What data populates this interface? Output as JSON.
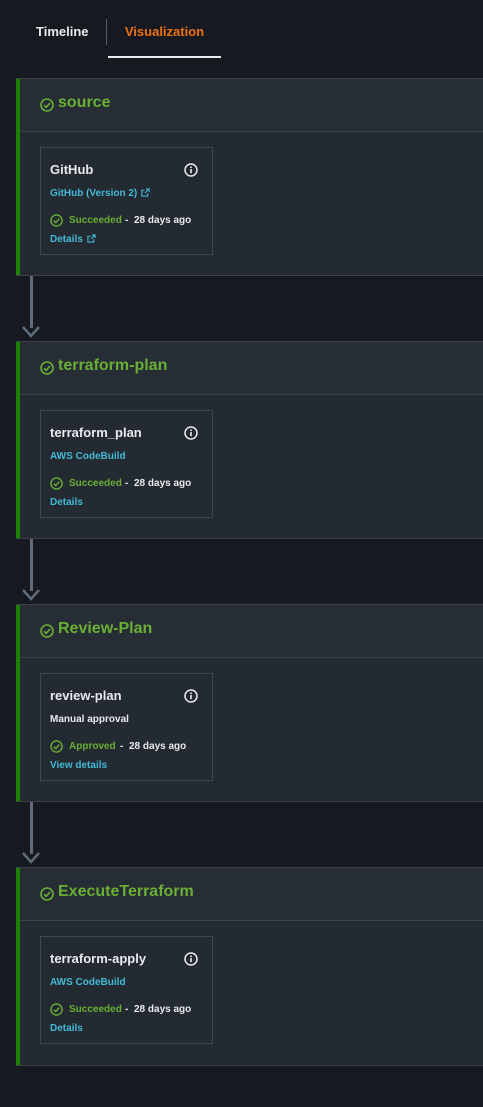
{
  "tabs": {
    "timeline": "Timeline",
    "visualization": "Visualization"
  },
  "stages": [
    {
      "title": "source",
      "action": {
        "name": "GitHub",
        "provider": "GitHub (Version 2)",
        "status": "Succeeded",
        "time": "28 days ago",
        "details": "Details"
      }
    },
    {
      "title": "terraform-plan",
      "action": {
        "name": "terraform_plan",
        "provider": "AWS CodeBuild",
        "status": "Succeeded",
        "time": "28 days ago",
        "details": "Details"
      }
    },
    {
      "title": "Review-Plan",
      "action": {
        "name": "review-plan",
        "provider": "Manual approval",
        "status": "Approved",
        "time": "28 days ago",
        "details": "View details"
      }
    },
    {
      "title": "ExecuteTerraform",
      "action": {
        "name": "terraform-apply",
        "provider": "AWS CodeBuild",
        "status": "Succeeded",
        "time": "28 days ago",
        "details": "Details"
      }
    }
  ],
  "separator": "-",
  "colors": {
    "success": "#6aaf35",
    "accent_tab": "#ec7211",
    "link": "#44b9d6",
    "stage_bar": "#1d8102"
  }
}
